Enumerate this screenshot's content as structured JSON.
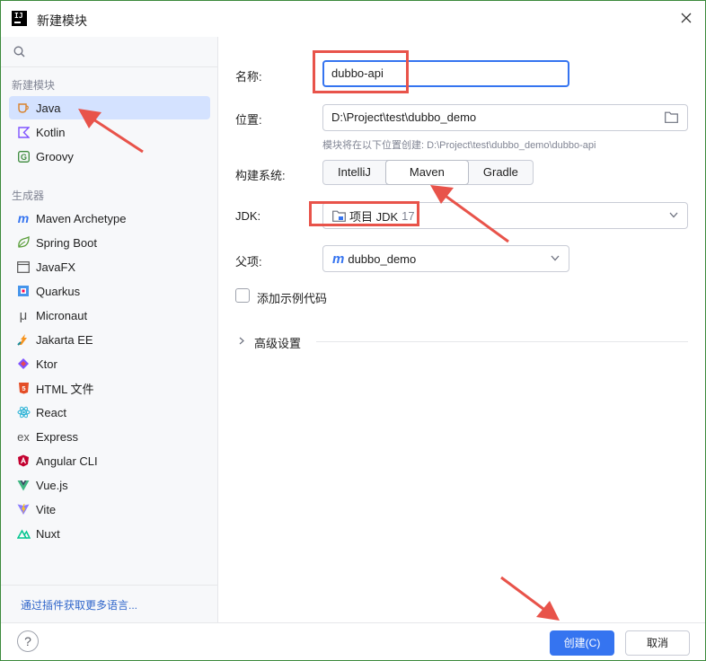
{
  "window": {
    "title": "新建模块"
  },
  "sidebar": {
    "search": {
      "placeholder": ""
    },
    "groups": [
      {
        "label": "新建模块"
      },
      {
        "label": "生成器"
      }
    ],
    "items": [
      {
        "label": "Java",
        "icon": "java-cup-icon",
        "selected": true
      },
      {
        "label": "Kotlin",
        "icon": "kotlin-icon"
      },
      {
        "label": "Groovy",
        "icon": "groovy-icon"
      },
      {
        "label": "Maven Archetype",
        "icon": "maven-m-icon"
      },
      {
        "label": "Spring Boot",
        "icon": "spring-boot-icon"
      },
      {
        "label": "JavaFX",
        "icon": "window-icon"
      },
      {
        "label": "Quarkus",
        "icon": "quarkus-icon"
      },
      {
        "label": "Micronaut",
        "icon": "micronaut-mu-icon"
      },
      {
        "label": "Jakarta EE",
        "icon": "jakarta-ee-icon"
      },
      {
        "label": "Ktor",
        "icon": "ktor-icon"
      },
      {
        "label": "HTML 文件",
        "icon": "html5-icon"
      },
      {
        "label": "React",
        "icon": "react-atom-icon"
      },
      {
        "label": "Express",
        "icon": "express-ex-icon"
      },
      {
        "label": "Angular CLI",
        "icon": "angular-icon"
      },
      {
        "label": "Vue.js",
        "icon": "vue-icon"
      },
      {
        "label": "Vite",
        "icon": "vite-icon"
      },
      {
        "label": "Nuxt",
        "icon": "nuxt-icon"
      }
    ],
    "footer_link": "通过插件获取更多语言..."
  },
  "form": {
    "name": {
      "label": "名称:",
      "value": "dubbo-api"
    },
    "location": {
      "label": "位置:",
      "value": "D:\\Project\\test\\dubbo_demo",
      "hint": "模块将在以下位置创建: D:\\Project\\test\\dubbo_demo\\dubbo-api"
    },
    "build_system": {
      "label": "构建系统:",
      "options": [
        "IntelliJ",
        "Maven",
        "Gradle"
      ],
      "selected": "Maven"
    },
    "jdk": {
      "label": "JDK:",
      "value": "项目 JDK",
      "version": "17"
    },
    "parent": {
      "label": "父项:",
      "value": "dubbo_demo"
    },
    "sample_code": {
      "label": "添加示例代码",
      "checked": false
    },
    "advanced": {
      "label": "高级设置"
    }
  },
  "buttons": {
    "help": "?",
    "create": "创建(C)",
    "cancel": "取消"
  },
  "colors": {
    "accent": "#3574f0",
    "selection": "#d4e2ff",
    "annotation": "#e8534a"
  }
}
